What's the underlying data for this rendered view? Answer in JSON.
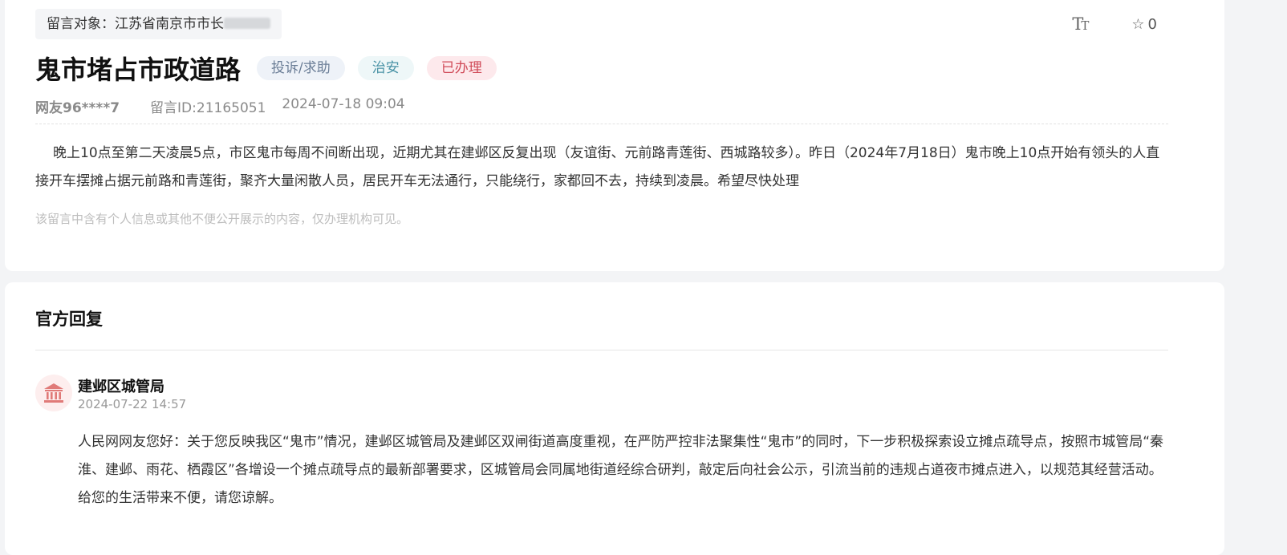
{
  "message": {
    "target_label": "留言对象：江苏省南京市市长",
    "title": "鬼市堵占市政道路",
    "tags": {
      "type": "投诉/求助",
      "category": "治安",
      "status": "已办理"
    },
    "toolbar": {
      "font_icon": "text-size-icon",
      "star_icon": "star-outline-icon",
      "star_count": "0"
    },
    "author": "网友96****7",
    "message_id": "留言ID:21165051",
    "datetime": "2024-07-18 09:04",
    "body": "晚上10点至第二天凌晨5点，市区鬼市每周不间断出现，近期尤其在建邺区反复出现（友谊街、元前路青莲街、西城路较多）。昨日（2024年7月18日）鬼市晚上10点开始有领头的人直接开车摆摊占据元前路和青莲街，聚齐大量闲散人员，居民开车无法通行，只能绕行，家都回不去，持续到凌晨。希望尽快处理",
    "privacy_note": "该留言中含有个人信息或其他不便公开展示的内容，仅办理机构可见。"
  },
  "reply": {
    "section_title": "官方回复",
    "department": "建邺区城管局",
    "department_icon": "government-building-icon",
    "date": "2024-07-22 14:57",
    "body": "人民网网友您好：关于您反映我区“鬼市”情况，建邺区城管局及建邺区双闸街道高度重视，在严防严控非法聚集性“鬼市”的同时，下一步积极探索设立摊点疏导点，按照市城管局“秦淮、建邺、雨花、栖霞区”各增设一个摊点疏导点的最新部署要求，区城管局会同属地街道经综合研判，敲定后向社会公示，引流当前的违规占道夜市摊点进入，以规范其经营活动。给您的生活带来不便，请您谅解。"
  },
  "colors": {
    "tag_type": "#6a7d96",
    "tag_category": "#4a93a6",
    "tag_status": "#d04a58",
    "avatar_icon": "#e07a78"
  }
}
